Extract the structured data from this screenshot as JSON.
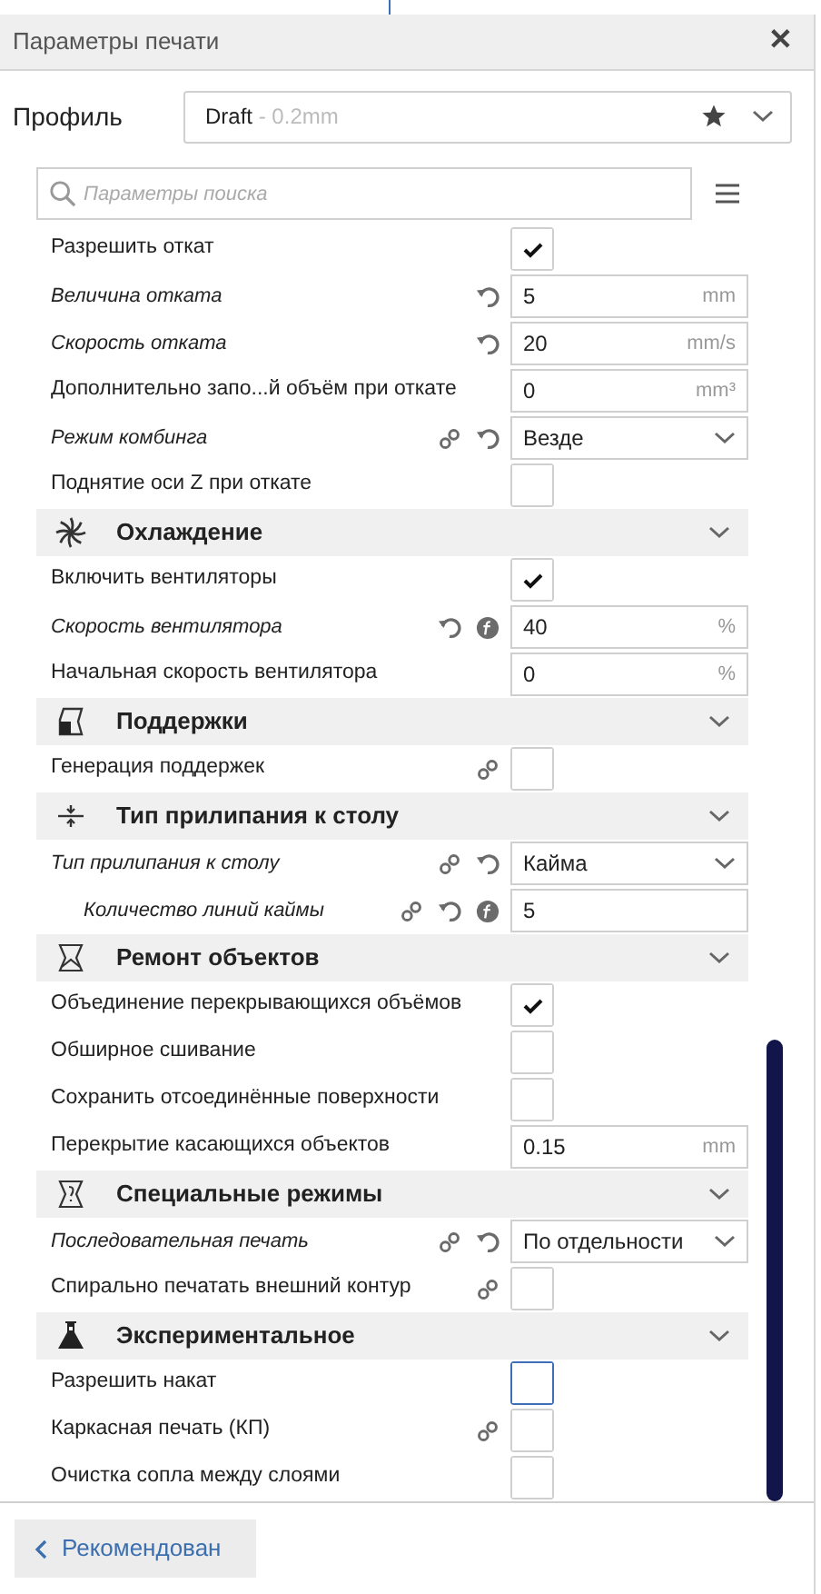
{
  "window": {
    "title": "Параметры печати",
    "close": "✕"
  },
  "profile": {
    "label": "Профиль",
    "name": "Draft",
    "detail": " - 0.2mm"
  },
  "search": {
    "placeholder": "Параметры поиска"
  },
  "settings": [
    {
      "kind": "check",
      "label": "Разрешить откат",
      "modified": false,
      "checked": true,
      "highlighted": false,
      "linked": false,
      "resettable": false,
      "function": false
    },
    {
      "kind": "number",
      "label": "Величина отката",
      "modified": true,
      "value": "5",
      "unit": "mm",
      "linked": false,
      "resettable": true,
      "function": false
    },
    {
      "kind": "number",
      "label": "Скорость отката",
      "modified": true,
      "value": "20",
      "unit": "mm/s",
      "linked": false,
      "resettable": true,
      "function": false
    },
    {
      "kind": "number",
      "label": "Дополнительно запо...й объём при откате",
      "modified": false,
      "value": "0",
      "unit": "mm³",
      "linked": false,
      "resettable": false,
      "function": false
    },
    {
      "kind": "select",
      "label": "Режим комбинга",
      "modified": true,
      "value": "Везде",
      "linked": true,
      "resettable": true,
      "function": false
    },
    {
      "kind": "check",
      "label": "Поднятие оси Z при откате",
      "modified": false,
      "checked": false,
      "highlighted": false,
      "linked": false,
      "resettable": false,
      "function": false
    },
    {
      "kind": "category",
      "title": "Охлаждение",
      "expanded": true
    },
    {
      "kind": "check",
      "label": "Включить вентиляторы",
      "modified": false,
      "checked": true,
      "highlighted": false,
      "linked": false,
      "resettable": false,
      "function": false
    },
    {
      "kind": "number",
      "label": "Скорость вентилятора",
      "modified": true,
      "value": "40",
      "unit": "%",
      "linked": false,
      "resettable": true,
      "function": true
    },
    {
      "kind": "number",
      "label": "Начальная скорость вентилятора",
      "modified": false,
      "value": "0",
      "unit": "%",
      "linked": false,
      "resettable": false,
      "function": false
    },
    {
      "kind": "category",
      "title": "Поддержки",
      "expanded": true
    },
    {
      "kind": "check",
      "label": "Генерация поддержек",
      "modified": false,
      "checked": false,
      "highlighted": false,
      "linked": true,
      "resettable": false,
      "function": false
    },
    {
      "kind": "category",
      "title": "Тип прилипания к столу",
      "expanded": true
    },
    {
      "kind": "select",
      "label": "Тип прилипания к столу",
      "modified": true,
      "value": "Кайма",
      "linked": true,
      "resettable": true,
      "function": false,
      "children": [
        {
          "kind": "number",
          "label": "Количество линий каймы",
          "modified": true,
          "value": "5",
          "linked": true,
          "resettable": true,
          "function": true
        }
      ]
    },
    {
      "kind": "category",
      "title": "Ремонт объектов",
      "expanded": true
    },
    {
      "kind": "check",
      "label": "Объединение перекрывающихся объёмов",
      "modified": false,
      "checked": true,
      "highlighted": false,
      "linked": false,
      "resettable": false,
      "function": false
    },
    {
      "kind": "check",
      "label": "Обширное сшивание",
      "modified": false,
      "checked": false,
      "highlighted": false,
      "linked": false,
      "resettable": false,
      "function": false
    },
    {
      "kind": "check",
      "label": "Сохранить отсоединённые поверхности",
      "modified": false,
      "checked": false,
      "highlighted": false,
      "linked": false,
      "resettable": false,
      "function": false
    },
    {
      "kind": "number",
      "label": "Перекрытие касающихся объектов",
      "modified": false,
      "value": "0.15",
      "unit": "mm",
      "linked": false,
      "resettable": false,
      "function": false
    },
    {
      "kind": "category",
      "title": "Специальные режимы",
      "expanded": true
    },
    {
      "kind": "select",
      "label": "Последовательная печать",
      "modified": true,
      "value": "По отдельности",
      "linked": true,
      "resettable": true,
      "function": false
    },
    {
      "kind": "check",
      "label": "Спирально печатать внешний контур",
      "modified": false,
      "checked": false,
      "highlighted": false,
      "linked": true,
      "resettable": false,
      "function": false
    },
    {
      "kind": "category",
      "title": "Экспериментальное",
      "expanded": true
    },
    {
      "kind": "check",
      "label": "Разрешить накат",
      "modified": false,
      "checked": false,
      "highlighted": true,
      "linked": false,
      "resettable": false,
      "function": false
    },
    {
      "kind": "check",
      "label": "Каркасная печать (КП)",
      "modified": false,
      "checked": false,
      "highlighted": false,
      "linked": true,
      "resettable": false,
      "function": false
    },
    {
      "kind": "check",
      "label": "Очистка сопла между слоями",
      "modified": false,
      "checked": false,
      "highlighted": false,
      "linked": false,
      "resettable": false,
      "function": false
    }
  ],
  "footer": {
    "button": "Рекомендован"
  }
}
